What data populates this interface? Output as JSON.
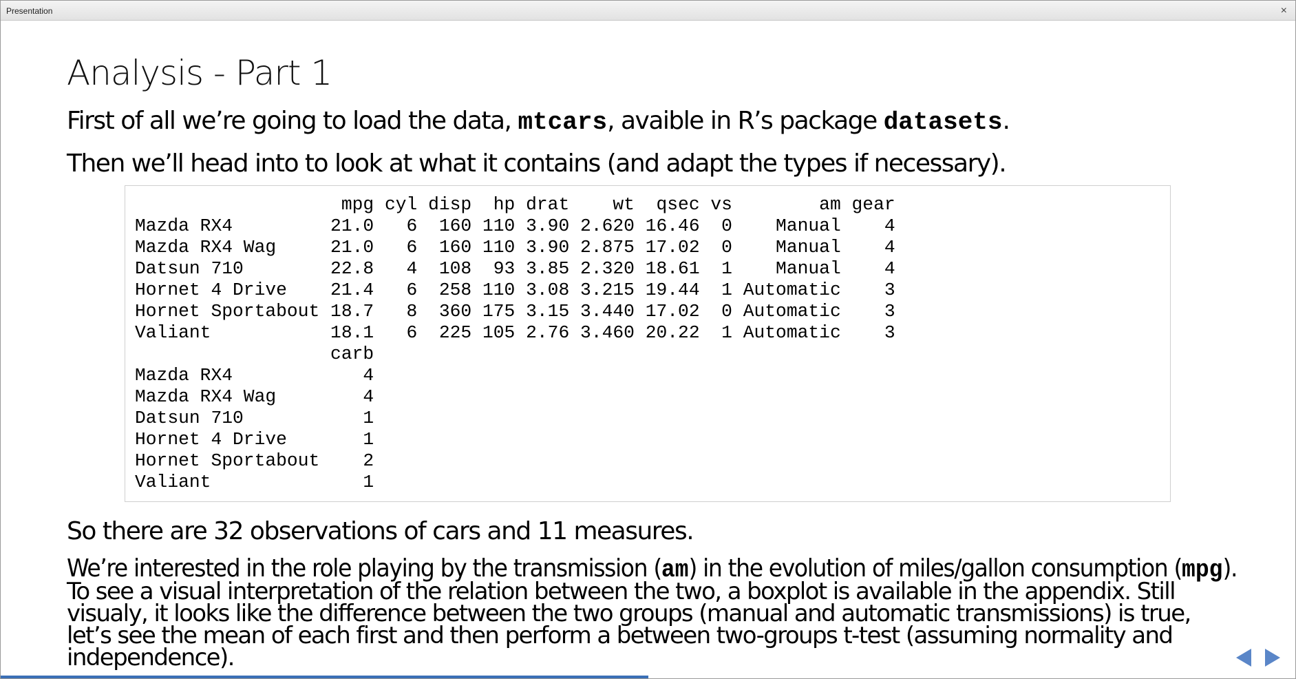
{
  "window": {
    "title": "Presentation",
    "close_symbol": "×"
  },
  "slide": {
    "title": "Analysis - Part 1",
    "p1": {
      "pre": "First of all we’re going to load the data, ",
      "code1": "mtcars",
      "mid": ", avaible in R’s package ",
      "code2": "datasets",
      "post": "."
    },
    "p2": "Then we’ll head into to look at what it contains (and adapt the types if necessary).",
    "code_output": "                   mpg cyl disp  hp drat    wt  qsec vs        am gear\nMazda RX4         21.0   6  160 110 3.90 2.620 16.46  0    Manual    4\nMazda RX4 Wag     21.0   6  160 110 3.90 2.875 17.02  0    Manual    4\nDatsun 710        22.8   4  108  93 3.85 2.320 18.61  1    Manual    4\nHornet 4 Drive    21.4   6  258 110 3.08 3.215 19.44  1 Automatic    3\nHornet Sportabout 18.7   8  360 175 3.15 3.440 17.02  0 Automatic    3\nValiant           18.1   6  225 105 2.76 3.460 20.22  1 Automatic    3\n                  carb\nMazda RX4            4\nMazda RX4 Wag        4\nDatsun 710           1\nHornet 4 Drive       1\nHornet Sportabout    2\nValiant              1",
    "p3": "So there are 32 observations of cars and 11 measures.",
    "p4": {
      "pre": "We’re interested in the role playing by the transmission (",
      "code1": "am",
      "mid": ") in the evolution of miles/gallon consumption (",
      "code2": "mpg",
      "post": ")."
    },
    "p5": "To see a visual interpretation of the relation between the two, a boxplot is available in the appendix. Still visualy, it looks like the difference between the two groups (manual and automatic transmissions) is true, let’s see the mean of each first and then perform a between two-groups t-test (assuming normality and independence)."
  },
  "navigation": {
    "prev_icon": "triangle-left-icon",
    "next_icon": "triangle-right-icon"
  },
  "progress": {
    "fraction": 0.5
  },
  "colors": {
    "accent": "#5a86c8",
    "progress": "#3a6fb6"
  }
}
